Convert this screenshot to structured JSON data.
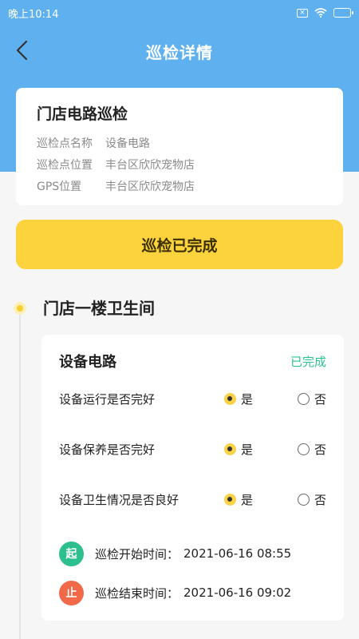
{
  "status_bar": {
    "time": "晚上10:14"
  },
  "nav": {
    "title": "巡检详情"
  },
  "info": {
    "title": "门店电路巡检",
    "rows": [
      {
        "label": "巡检点名称",
        "value": "设备电路"
      },
      {
        "label": "巡检点位置",
        "value": "丰台区欣欣宠物店"
      },
      {
        "label": "GPS位置",
        "value": "丰台区欣欣宠物店"
      }
    ]
  },
  "status_button": {
    "label": "巡检已完成"
  },
  "section": {
    "title": "门店一楼卫生间"
  },
  "item": {
    "name": "设备电路",
    "status": "已完成",
    "options": {
      "yes": "是",
      "no": "否"
    },
    "questions": [
      {
        "text": "设备运行是否完好",
        "answer": "yes"
      },
      {
        "text": "设备保养是否完好",
        "answer": "yes"
      },
      {
        "text": "设备卫生情况是否良好",
        "answer": "yes"
      }
    ],
    "times": [
      {
        "badge": "起",
        "label": "巡检开始时间：",
        "value": "2021-06-16 08:55",
        "color": "#2dbf8e"
      },
      {
        "badge": "止",
        "label": "巡检结束时间：",
        "value": "2021-06-16 09:02",
        "color": "#f2694a"
      }
    ]
  },
  "colors": {
    "header": "#5fb0ee",
    "accent": "#fcd23d",
    "done": "#2ec28f"
  }
}
